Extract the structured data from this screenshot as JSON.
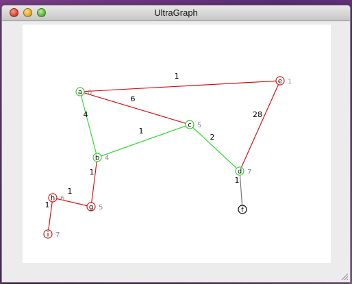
{
  "window": {
    "title": "UltraGraph"
  },
  "graph": {
    "nodes": [
      {
        "id": "a",
        "weight": "0",
        "color": "#33cc33"
      },
      {
        "id": "b",
        "weight": "4",
        "color": "#33cc33"
      },
      {
        "id": "c",
        "weight": "5",
        "color": "#33cc33"
      },
      {
        "id": "d",
        "weight": "7",
        "color": "#33cc33"
      },
      {
        "id": "e",
        "weight": "1",
        "color": "#dd1111"
      },
      {
        "id": "f",
        "weight": "",
        "color": "#000000"
      },
      {
        "id": "g",
        "weight": "5",
        "color": "#dd1111"
      },
      {
        "id": "h",
        "weight": "6",
        "color": "#dd1111"
      },
      {
        "id": "i",
        "weight": "7",
        "color": "#dd1111"
      }
    ],
    "edges": [
      {
        "from": "a",
        "to": "e",
        "label": "1",
        "color": "#dd1111"
      },
      {
        "from": "a",
        "to": "c",
        "label": "6",
        "color": "#dd1111"
      },
      {
        "from": "a",
        "to": "b",
        "label": "4",
        "color": "#33dd33"
      },
      {
        "from": "b",
        "to": "c",
        "label": "1",
        "color": "#33dd33"
      },
      {
        "from": "c",
        "to": "d",
        "label": "2",
        "color": "#33dd33"
      },
      {
        "from": "e",
        "to": "d",
        "label": "28",
        "color": "#dd1111"
      },
      {
        "from": "b",
        "to": "g",
        "label": "1",
        "color": "#dd1111"
      },
      {
        "from": "d",
        "to": "f",
        "label": "1",
        "color": "#777777"
      },
      {
        "from": "h",
        "to": "g",
        "label": "1",
        "color": "#dd1111"
      },
      {
        "from": "h",
        "to": "i",
        "label": "1",
        "color": "#dd1111"
      }
    ]
  }
}
